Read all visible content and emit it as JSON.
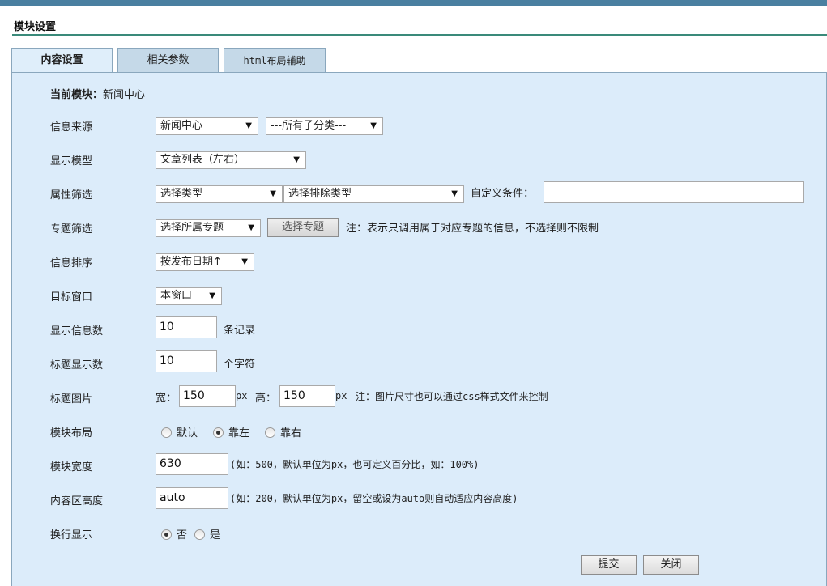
{
  "header": {
    "title": "模块设置"
  },
  "tabs": [
    {
      "label": "内容设置",
      "active": true
    },
    {
      "label": "相关参数",
      "active": false
    },
    {
      "label": "html布局辅助",
      "active": false
    }
  ],
  "current_module": {
    "label": "当前模块：",
    "value": "新闻中心"
  },
  "rows": {
    "source": {
      "label": "信息来源",
      "select1": "新闻中心",
      "select2": "---所有子分类---"
    },
    "model": {
      "label": "显示模型",
      "select": "文章列表（左右）"
    },
    "attr": {
      "label": "属性筛选",
      "select1": "选择类型",
      "select2": "选择排除类型",
      "custom_label": "自定义条件：",
      "custom_value": ""
    },
    "topic": {
      "label": "专题筛选",
      "select": "选择所属专题",
      "button": "选择专题",
      "note": "注：表示只调用属于对应专题的信息，不选择则不限制"
    },
    "sort": {
      "label": "信息排序",
      "select": "按发布日期↑"
    },
    "target": {
      "label": "目标窗口",
      "select": "本窗口"
    },
    "count": {
      "label": "显示信息数",
      "value": "10",
      "suffix": "条记录"
    },
    "title_len": {
      "label": "标题显示数",
      "value": "10",
      "suffix": "个字符"
    },
    "title_img": {
      "label": "标题图片",
      "width_label": "宽：",
      "width_value": "150",
      "unit1": "px",
      "height_label": "高：",
      "height_value": "150",
      "unit2": "px",
      "note": "注：图片尺寸也可以通过css样式文件来控制"
    },
    "layout": {
      "label": "模块布局",
      "options": [
        "默认",
        "靠左",
        "靠右"
      ],
      "selected": "靠左"
    },
    "width": {
      "label": "模块宽度",
      "value": "630",
      "note": "(如：500，默认单位为px，也可定义百分比，如：100%)"
    },
    "height": {
      "label": "内容区高度",
      "value": "auto",
      "note": "(如：200，默认单位为px，留空或设为auto则自动适应内容高度)"
    },
    "wrap": {
      "label": "换行显示",
      "options": [
        "否",
        "是"
      ],
      "selected": "否"
    }
  },
  "actions": {
    "submit": "提交",
    "close": "关闭"
  },
  "colors": {
    "panel": "#dcecfa",
    "tab_border": "#8aa7bd",
    "title_line": "#3a8a7a",
    "topbar": "#4a7fa0"
  }
}
